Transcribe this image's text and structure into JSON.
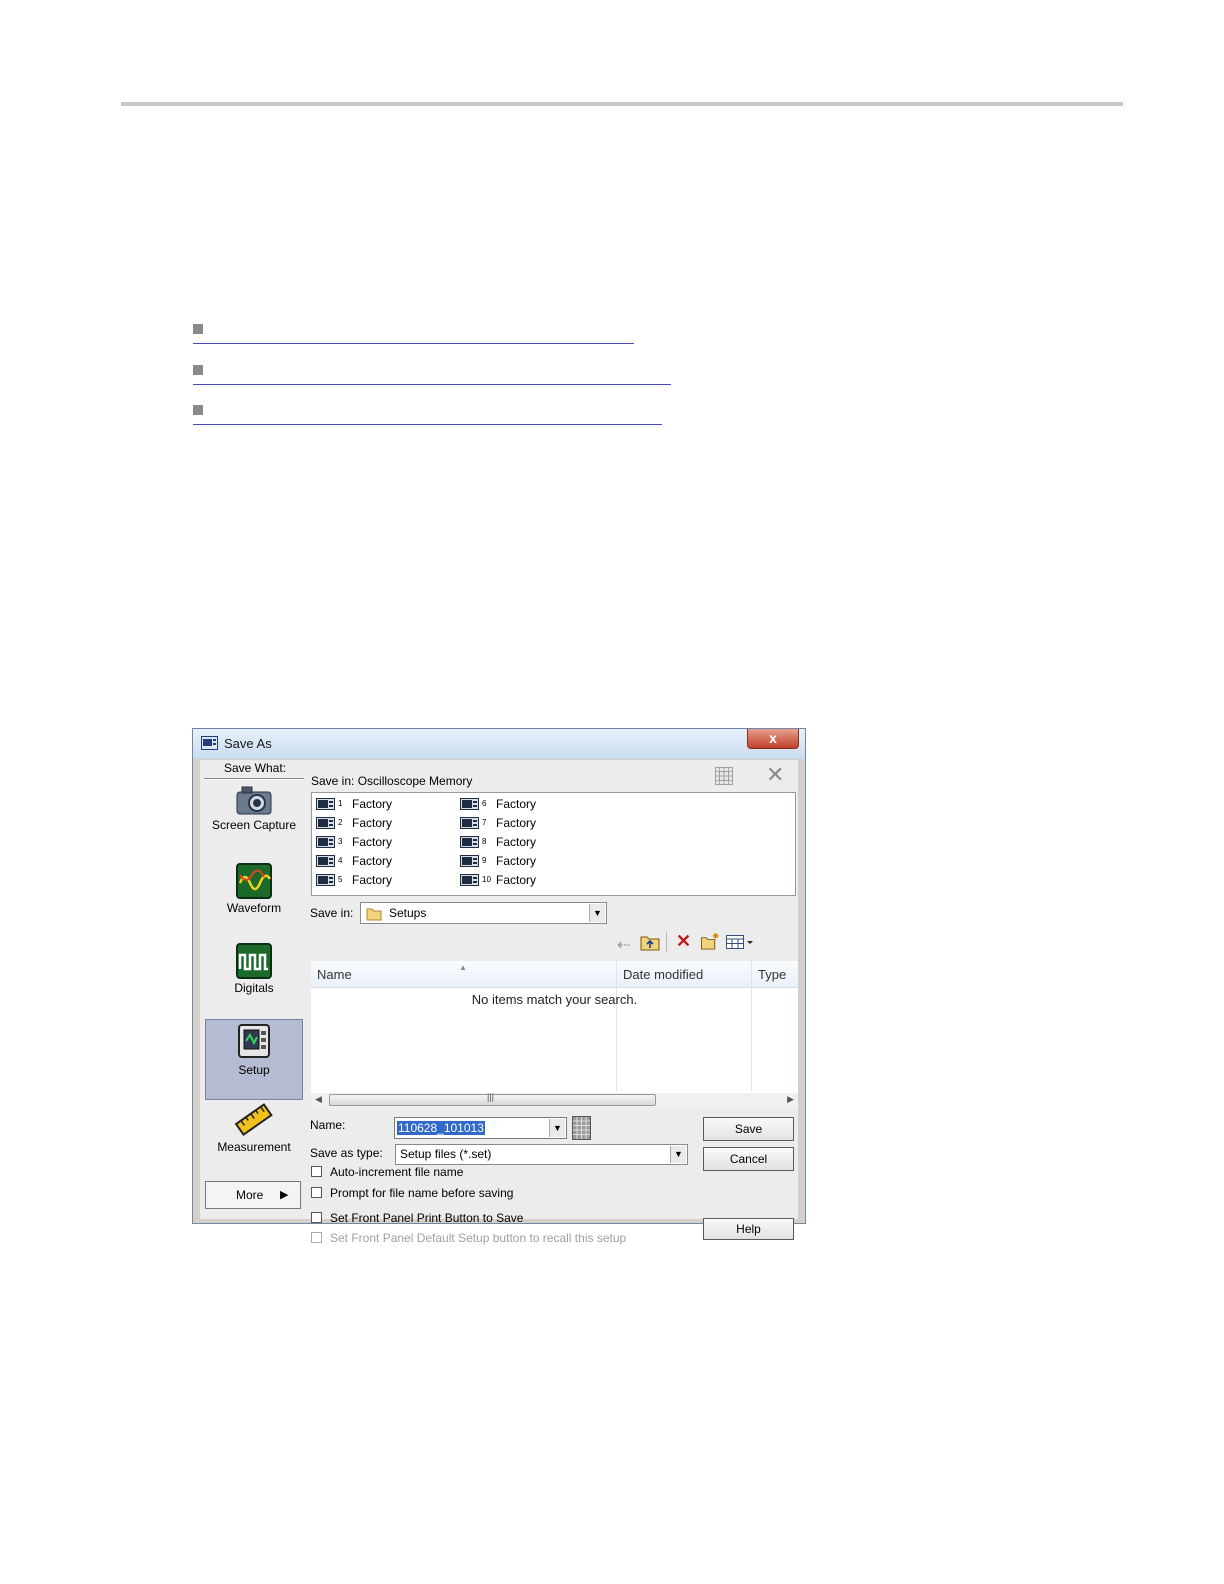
{
  "dialog": {
    "title": "Save As",
    "close_glyph": "x",
    "save_what_label": "Save What:",
    "categories": [
      {
        "label": "Screen Capture",
        "icon": "camera-icon"
      },
      {
        "label": "Waveform",
        "icon": "waveform-icon"
      },
      {
        "label": "Digitals",
        "icon": "digitals-icon"
      },
      {
        "label": "Setup",
        "icon": "setup-icon",
        "selected": true
      },
      {
        "label": "Measurement",
        "icon": "measurement-ruler-icon"
      }
    ],
    "more_label": "More",
    "memory": {
      "label": "Save in: Oscilloscope Memory",
      "items": [
        {
          "num": "1",
          "name": "Factory"
        },
        {
          "num": "2",
          "name": "Factory"
        },
        {
          "num": "3",
          "name": "Factory"
        },
        {
          "num": "4",
          "name": "Factory"
        },
        {
          "num": "5",
          "name": "Factory"
        },
        {
          "num": "6",
          "name": "Factory"
        },
        {
          "num": "7",
          "name": "Factory"
        },
        {
          "num": "8",
          "name": "Factory"
        },
        {
          "num": "9",
          "name": "Factory"
        },
        {
          "num": "10",
          "name": "Factory"
        }
      ]
    },
    "save_in": {
      "label": "Save in:",
      "value": "Setups"
    },
    "columns": [
      "Name",
      "Date modified",
      "Type"
    ],
    "empty_message": "No items match your search.",
    "name_field": {
      "label": "Name:",
      "value": "110628_101013"
    },
    "save_as_type": {
      "label": "Save as type:",
      "value": "Setup files (*.set)"
    },
    "buttons": {
      "save": "Save",
      "cancel": "Cancel",
      "help": "Help"
    },
    "checkboxes": [
      {
        "label": "Auto-increment file name",
        "checked": false,
        "enabled": true
      },
      {
        "label": "Prompt for file name before saving",
        "checked": false,
        "enabled": true
      },
      {
        "label": "Set Front Panel Print Button to Save",
        "checked": false,
        "enabled": true
      },
      {
        "label": "Set Front Panel Default Setup button to recall this setup",
        "checked": false,
        "enabled": false
      }
    ]
  }
}
